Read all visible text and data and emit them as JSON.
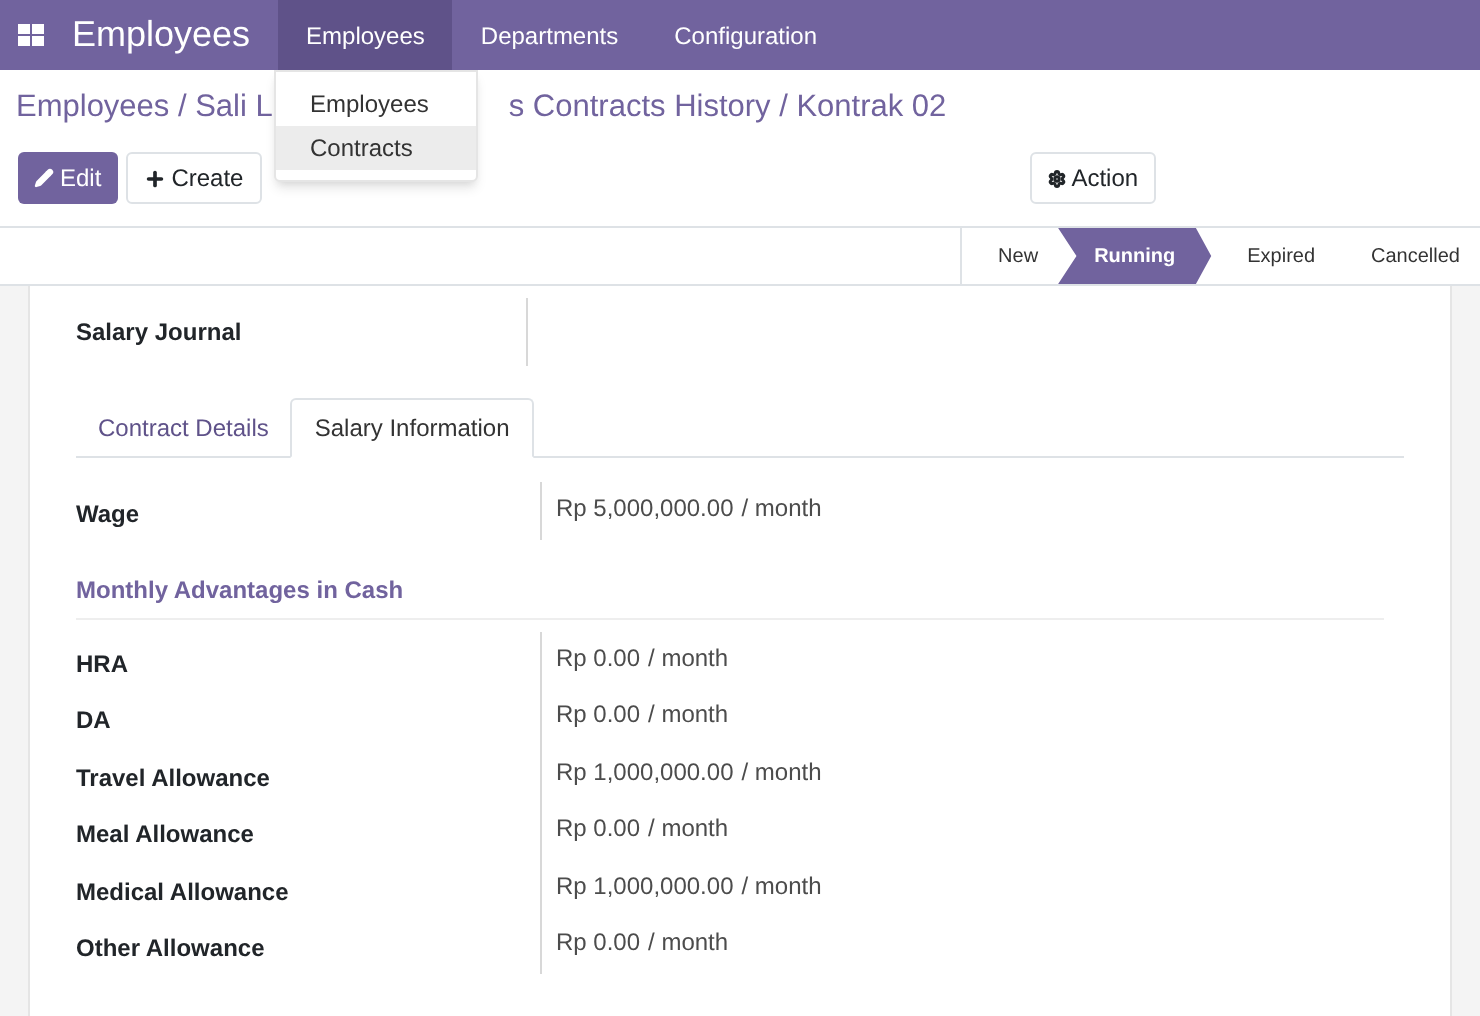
{
  "navbar": {
    "app_title": "Employees",
    "menus": [
      {
        "label": "Employees",
        "selected": true
      },
      {
        "label": "Departments",
        "selected": false
      },
      {
        "label": "Configuration",
        "selected": false
      }
    ]
  },
  "dropdown": {
    "items": [
      {
        "label": "Employees",
        "selected": false
      },
      {
        "label": "Contracts",
        "selected": true
      }
    ]
  },
  "breadcrumb": {
    "before": "Employees / Sali L",
    "after": "s Contracts History / Kontrak 02"
  },
  "buttons": {
    "edit": "Edit",
    "create": "Create",
    "action": "Action"
  },
  "stages": [
    {
      "label": "New",
      "selected": false
    },
    {
      "label": "Running",
      "selected": true
    },
    {
      "label": "Expired",
      "selected": false
    },
    {
      "label": "Cancelled",
      "selected": false
    }
  ],
  "top_field": {
    "label": "Salary Journal"
  },
  "tabs": [
    {
      "label": "Contract Details",
      "selected": false
    },
    {
      "label": "Salary Information",
      "selected": true
    }
  ],
  "wage": {
    "label": "Wage",
    "value": "Rp 5,000,000.00",
    "unit": "/ month"
  },
  "section_title": "Monthly Advantages in Cash",
  "advantages": [
    {
      "label": "HRA",
      "value": "Rp 0.00",
      "unit": "/ month"
    },
    {
      "label": "DA",
      "value": "Rp 0.00",
      "unit": "/ month"
    },
    {
      "label": "Travel Allowance",
      "value": "Rp 1,000,000.00",
      "unit": "/ month"
    },
    {
      "label": "Meal Allowance",
      "value": "Rp 0.00",
      "unit": "/ month"
    },
    {
      "label": "Medical Allowance",
      "value": "Rp 1,000,000.00",
      "unit": "/ month"
    },
    {
      "label": "Other Allowance",
      "value": "Rp 0.00",
      "unit": "/ month"
    }
  ]
}
